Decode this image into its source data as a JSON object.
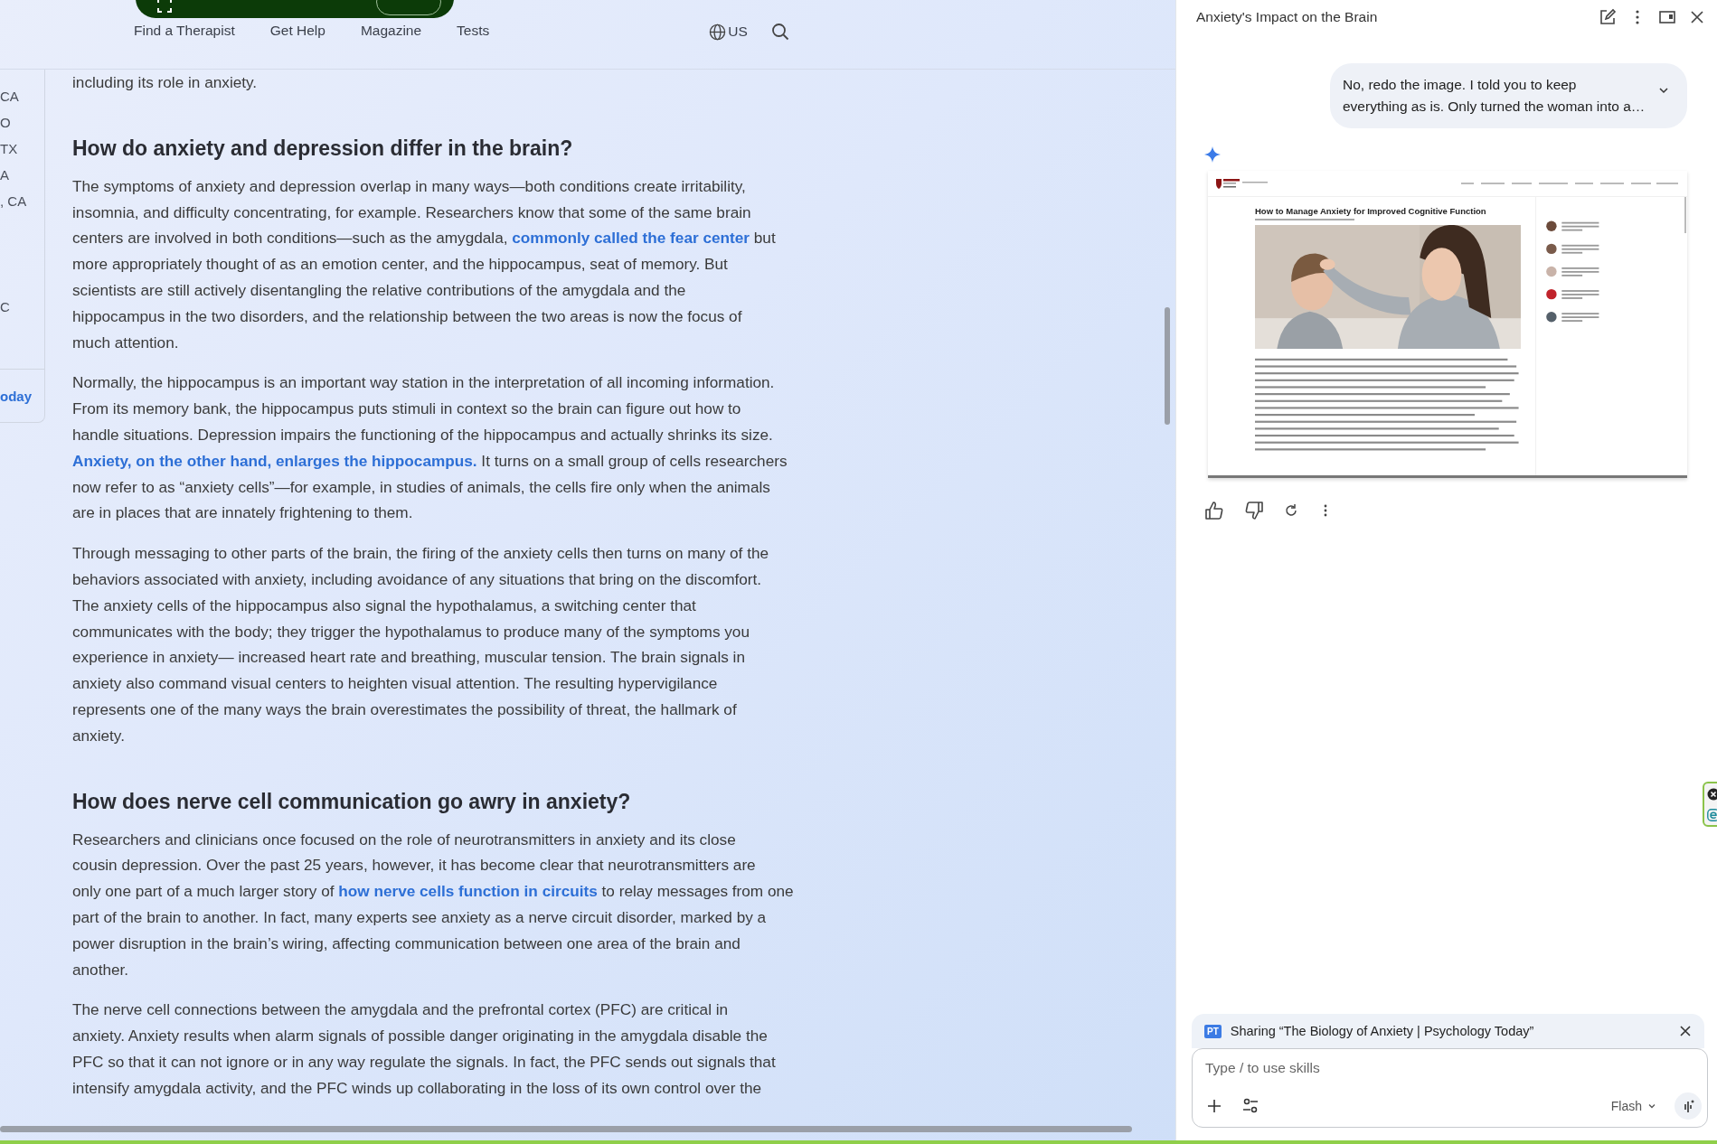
{
  "page_nav": {
    "items": [
      {
        "label": "Find a Therapist"
      },
      {
        "label": "Get Help"
      },
      {
        "label": "Magazine"
      },
      {
        "label": "Tests"
      }
    ],
    "region": "US"
  },
  "sidebar_fragments": {
    "groups": [
      [
        "CA",
        "O",
        "TX",
        "A",
        ", CA"
      ],
      [
        "C"
      ]
    ],
    "footer_link": "oday"
  },
  "article": {
    "blocks": [
      {
        "kind": "paragraph",
        "segments": [
          {
            "kind": "text",
            "text": "including its role in anxiety."
          }
        ]
      },
      {
        "kind": "heading",
        "text": "How do anxiety and depression differ in the brain?"
      },
      {
        "kind": "paragraph",
        "segments": [
          {
            "kind": "text",
            "text": "The symptoms of anxiety and depression overlap in many ways—both conditions create irritability,\ninsomnia, and difficulty concentrating, for example. Researchers know that some of the same brain\ncenters are involved in both conditions—such as the amygdala, "
          },
          {
            "kind": "link",
            "text": "commonly called the fear center"
          },
          {
            "kind": "text",
            "text": " but\nmore appropriately thought of as an emotion center, and the hippocampus, seat of memory. But\nscientists are still actively disentangling the relative contributions of the amygdala and the\nhippocampus in the two disorders, and the relationship between the two areas is now the focus of\nmuch attention."
          }
        ]
      },
      {
        "kind": "paragraph",
        "segments": [
          {
            "kind": "text",
            "text": "Normally, the hippocampus is an important way station in the interpretation of all incoming information.\nFrom its memory bank, the hippocampus puts stimuli in context so the brain can figure out how to\nhandle situations. Depression impairs the functioning of the hippocampus and actually shrinks its size.\n"
          },
          {
            "kind": "link",
            "text": "Anxiety, on the other hand, enlarges the hippocampus."
          },
          {
            "kind": "text",
            "text": " It turns on a small group of cells researchers\nnow refer to as “anxiety cells”—for example, in studies of animals, the cells fire only when the animals\nare in places that are innately frightening to them."
          }
        ]
      },
      {
        "kind": "paragraph",
        "segments": [
          {
            "kind": "text",
            "text": "Through messaging to other parts of the brain, the firing of the anxiety cells then turns on many of the\nbehaviors associated with anxiety, including avoidance of any situations that bring on the discomfort.\nThe anxiety cells of the hippocampus also signal the hypothalamus, a switching center that\ncommunicates with the body; they trigger the hypothalamus to produce many of the symptoms you\nexperience in anxiety— increased heart rate and breathing, muscular tension. The brain signals in\nanxiety also command visual centers to heighten visual attention. The resulting hypervigilance\nrepresents one of the many ways the brain overestimates the possibility of threat, the hallmark of\nanxiety."
          }
        ]
      },
      {
        "kind": "heading",
        "text": "How does nerve cell communication go awry in anxiety?"
      },
      {
        "kind": "paragraph",
        "segments": [
          {
            "kind": "text",
            "text": "Researchers and clinicians once focused on the role of neurotransmitters in anxiety and its close\ncousin depression. Over the past 25 years, however, it has become clear that neurotransmitters are\nonly one part of a much larger story of "
          },
          {
            "kind": "link",
            "text": "how nerve cells function in circuits"
          },
          {
            "kind": "text",
            "text": " to relay messages from one\npart of the brain to another. In fact, many experts see anxiety as a nerve circuit disorder, marked by a\npower disruption in the brain’s wiring, affecting communication between one area of the brain and\nanother."
          }
        ]
      },
      {
        "kind": "paragraph",
        "segments": [
          {
            "kind": "text",
            "text": "The nerve cell connections between the amygdala and the prefrontal cortex (PFC) are critical in\nanxiety. Anxiety results when alarm signals of possible danger originating in the amygdala disable the\nPFC so that it can not ignore or in any way regulate the signals. In fact, the PFC sends out signals that\nintensify amygdala activity, and the PFC winds up collaborating in the loss of its own control over the"
          }
        ]
      }
    ]
  },
  "assistant": {
    "title": "Anxiety's Impact on the Brain",
    "user_message": "No, redo the image. I told you to keep\neverything as is. Only turned the woman into a…",
    "response_image": {
      "title": "How to Manage Anxiety for Improved Cognitive Function"
    },
    "sharing": {
      "badge": "PT",
      "text": "Sharing “The Biology of Anxiety | Psychology Today”"
    },
    "input": {
      "placeholder": "Type / to use skills"
    },
    "model": "Flash"
  }
}
